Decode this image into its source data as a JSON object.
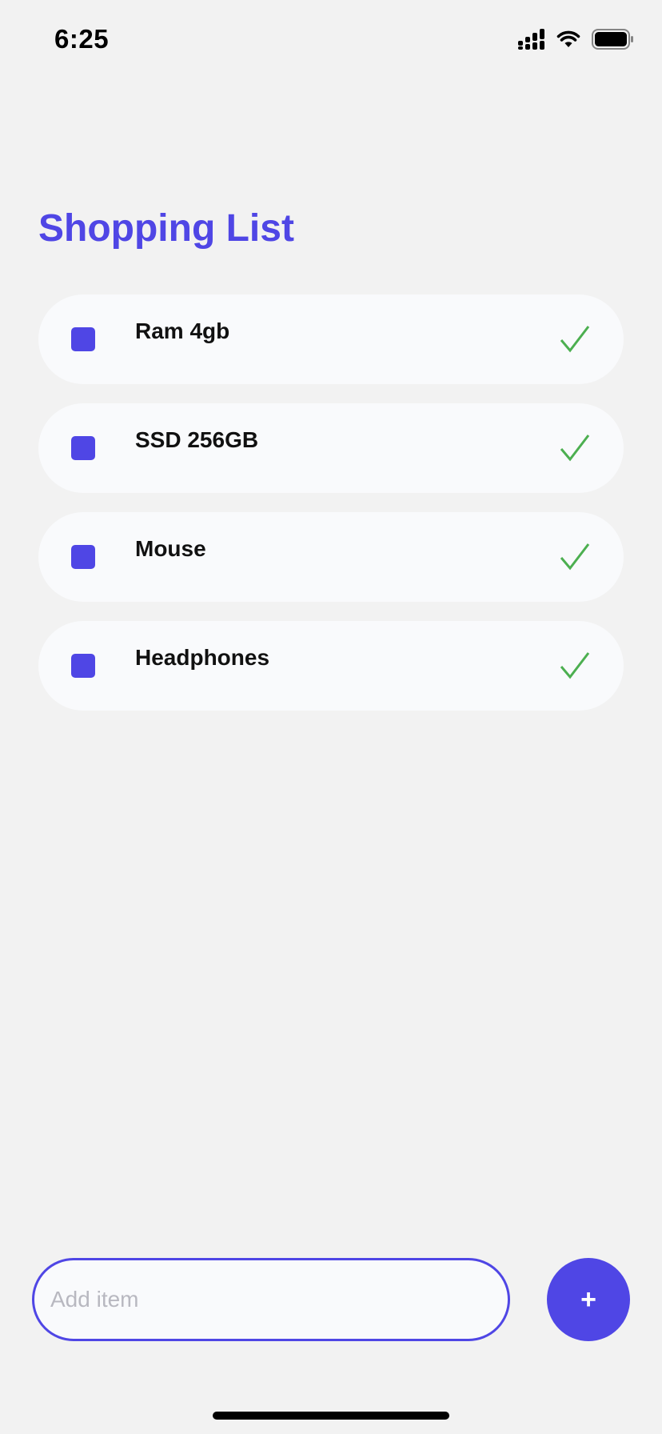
{
  "status_bar": {
    "time": "6:25",
    "signal_icon": "cellular-signal-icon",
    "wifi_icon": "wifi-icon",
    "battery_icon": "battery-icon"
  },
  "header": {
    "title": "Shopping List"
  },
  "items": [
    {
      "label": "Ram 4gb",
      "check_icon": "checkmark-icon"
    },
    {
      "label": "SSD 256GB",
      "check_icon": "checkmark-icon"
    },
    {
      "label": "Mouse",
      "check_icon": "checkmark-icon"
    },
    {
      "label": "Headphones",
      "check_icon": "checkmark-icon"
    }
  ],
  "add_form": {
    "input_value": "",
    "input_placeholder": "Add item",
    "button_label": "+"
  },
  "colors": {
    "accent": "#4f46e5",
    "check": "#4caf50",
    "background": "#f2f2f2",
    "card": "#f9fafc"
  }
}
